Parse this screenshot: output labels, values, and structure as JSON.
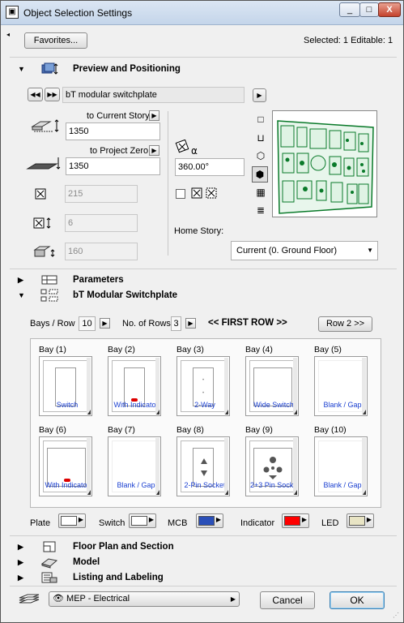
{
  "window": {
    "title": "Object Selection Settings",
    "minimize": "_",
    "maximize": "□",
    "close": "X"
  },
  "top": {
    "favorites": "Favorites...",
    "status": "Selected: 1 Editable: 1"
  },
  "preview": {
    "header": "Preview and Positioning",
    "object_name": "bT modular switchplate",
    "to_current_story": "to Current Story",
    "current_story_value": "1350",
    "to_project_zero": "to Project Zero",
    "project_zero_value": "1350",
    "dim_x": "215",
    "dim_y": "6",
    "dim_z": "160",
    "angle": "360.00°",
    "home_story_label": "Home Story:",
    "home_story_value": "Current (0. Ground Floor)"
  },
  "parameters": {
    "header": "Parameters"
  },
  "switchplate": {
    "header": "bT Modular Switchplate",
    "bays_row_label": "Bays / Row",
    "bays_row_value": "10",
    "rows_label": "No. of Rows",
    "rows_value": "3",
    "row_title": "<< FIRST ROW >>",
    "next_row": "Row 2 >>",
    "bays": [
      {
        "label": "Bay (1)",
        "caption": "Switch"
      },
      {
        "label": "Bay (2)",
        "caption": "With Indicator"
      },
      {
        "label": "Bay (3)",
        "caption": "2-Way"
      },
      {
        "label": "Bay (4)",
        "caption": "Wide Switch"
      },
      {
        "label": "Bay (5)",
        "caption": "Blank / Gap"
      },
      {
        "label": "Bay (6)",
        "caption": "With Indicator"
      },
      {
        "label": "Bay (7)",
        "caption": "Blank / Gap"
      },
      {
        "label": "Bay (8)",
        "caption": "2-Pin Socket"
      },
      {
        "label": "Bay (9)",
        "caption": "2+3 Pin Socket"
      },
      {
        "label": "Bay (10)",
        "caption": "Blank / Gap"
      }
    ],
    "colors": {
      "plate_label": "Plate",
      "plate": "#ffffff",
      "switch_label": "Switch",
      "switch": "#ffffff",
      "mcb_label": "MCB",
      "mcb": "#2a4fb8",
      "indicator_label": "Indicator",
      "indicator": "#ff0000",
      "led_label": "LED",
      "led": "#e8e4c4"
    }
  },
  "sections": {
    "floor_plan": "Floor Plan and Section",
    "model": "Model",
    "listing": "Listing and Labeling"
  },
  "footer": {
    "layer": "MEP - Electrical",
    "cancel": "Cancel",
    "ok": "OK"
  }
}
